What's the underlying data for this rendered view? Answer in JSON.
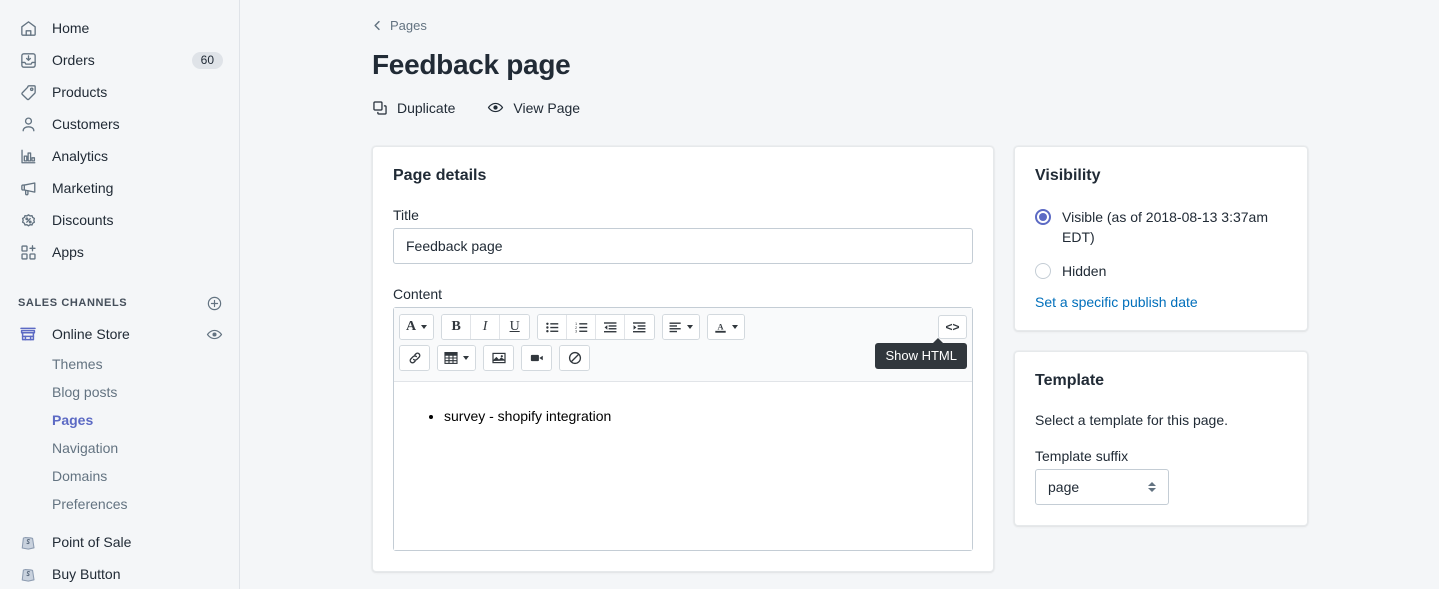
{
  "sidebar": {
    "nav_items": [
      {
        "label": "Home",
        "icon": "home-icon",
        "badge": null
      },
      {
        "label": "Orders",
        "icon": "orders-icon",
        "badge": "60"
      },
      {
        "label": "Products",
        "icon": "products-tag-icon",
        "badge": null
      },
      {
        "label": "Customers",
        "icon": "customers-person-icon",
        "badge": null
      },
      {
        "label": "Analytics",
        "icon": "analytics-bar-chart-icon",
        "badge": null
      },
      {
        "label": "Marketing",
        "icon": "marketing-megaphone-icon",
        "badge": null
      },
      {
        "label": "Discounts",
        "icon": "discounts-percent-icon",
        "badge": null
      },
      {
        "label": "Apps",
        "icon": "apps-grid-plus-icon",
        "badge": null
      }
    ],
    "section_title": "SALES CHANNELS",
    "add_channel_icon": "plus-circle-icon",
    "online_store": {
      "label": "Online Store",
      "icon": "storefront-icon",
      "view_icon": "eye-icon",
      "sub_items": [
        {
          "label": "Themes",
          "active": false
        },
        {
          "label": "Blog posts",
          "active": false
        },
        {
          "label": "Pages",
          "active": true
        },
        {
          "label": "Navigation",
          "active": false
        },
        {
          "label": "Domains",
          "active": false
        },
        {
          "label": "Preferences",
          "active": false
        }
      ]
    },
    "channels": [
      {
        "label": "Point of Sale",
        "icon": "shopify-bag-icon"
      },
      {
        "label": "Buy Button",
        "icon": "shopify-bag-icon"
      }
    ],
    "accent_color": "#5c6ac4"
  },
  "header": {
    "breadcrumb_label": "Pages",
    "breadcrumb_icon": "chevron-left-icon",
    "page_title": "Feedback page",
    "actions": [
      {
        "label": "Duplicate",
        "icon": "duplicate-icon"
      },
      {
        "label": "View Page",
        "icon": "eye-icon"
      }
    ]
  },
  "page_details": {
    "card_title": "Page details",
    "title_label": "Title",
    "title_value": "Feedback page",
    "title_placeholder": "",
    "content_label": "Content",
    "content_bullets": [
      "survey - shopify integration"
    ],
    "toolbar": {
      "row1": [
        {
          "group": [
            {
              "name": "font-style-button",
              "glyph": "A",
              "caret": true
            }
          ]
        },
        {
          "group": [
            {
              "name": "bold-button",
              "glyph": "B",
              "caret": false
            },
            {
              "name": "italic-button",
              "glyph": "I",
              "caret": false
            },
            {
              "name": "underline-button",
              "glyph": "U",
              "caret": false
            }
          ]
        },
        {
          "group": [
            {
              "name": "bulleted-list-button",
              "glyph": "list-bullet-icon",
              "caret": false
            },
            {
              "name": "numbered-list-button",
              "glyph": "list-number-icon",
              "caret": false
            },
            {
              "name": "outdent-button",
              "glyph": "outdent-icon",
              "caret": false
            },
            {
              "name": "indent-button",
              "glyph": "indent-icon",
              "caret": false
            }
          ]
        },
        {
          "group": [
            {
              "name": "align-button",
              "glyph": "align-left-icon",
              "caret": true
            }
          ]
        },
        {
          "group": [
            {
              "name": "text-color-button",
              "glyph": "text-color-icon",
              "caret": true
            }
          ]
        }
      ],
      "show_html_glyph": "<>",
      "row2": [
        {
          "name": "insert-link-button",
          "glyph": "link-icon",
          "caret": false
        },
        {
          "name": "insert-table-button",
          "glyph": "table-icon",
          "caret": true
        },
        {
          "name": "insert-image-button",
          "glyph": "image-icon",
          "caret": false
        },
        {
          "name": "insert-video-button",
          "glyph": "video-icon",
          "caret": false
        },
        {
          "name": "clear-formatting-button",
          "glyph": "no-symbol-icon",
          "caret": false
        }
      ],
      "tooltip": "Show HTML"
    }
  },
  "visibility": {
    "card_title": "Visibility",
    "options": [
      {
        "label": "Visible (as of 2018-08-13 3:37am EDT)",
        "checked": true
      },
      {
        "label": "Hidden",
        "checked": false
      }
    ],
    "link_label": "Set a specific publish date",
    "link_color": "#006fbb"
  },
  "template": {
    "card_title": "Template",
    "help_text": "Select a template for this page.",
    "suffix_label": "Template suffix",
    "suffix_value": "page"
  }
}
